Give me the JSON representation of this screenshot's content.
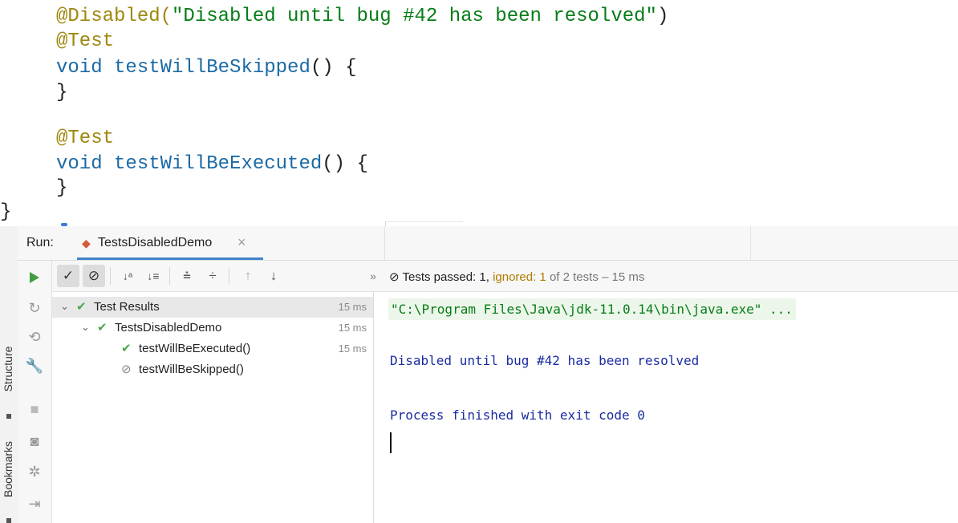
{
  "editor": {
    "disabled_annotation": "@Disabled(",
    "disabled_reason": "\"Disabled until bug #42 has been resolved\"",
    "disabled_close": ")",
    "test_annotation": "@Test",
    "void_keyword": "void",
    "method_skipped": "testWillBeSkipped",
    "method_executed": "testWillBeExecuted",
    "signature_tail": "() {",
    "close_brace": "}",
    "class_close_brace": "}"
  },
  "left_stripe": {
    "structure_label": "Structure",
    "bookmarks_label": "Bookmarks"
  },
  "run": {
    "label": "Run:",
    "tab_title": "TestsDisabledDemo",
    "tab_close": "×"
  },
  "toolbar": {
    "show_passed": "✓",
    "show_ignored": "⊘",
    "sort_alpha": "↓ᵃ",
    "sort_duration": "↓≡",
    "expand_all": "⩮",
    "collapse_all": "÷",
    "prev": "↑",
    "next": "↓",
    "more": "»"
  },
  "status": {
    "icon": "⊘",
    "passed_text": "Tests passed: 1,",
    "ignored_text": "ignored: 1",
    "rest_text": "of 2 tests – 15 ms"
  },
  "tree": {
    "root": {
      "label": "Test Results",
      "time": "15 ms"
    },
    "class": {
      "label": "TestsDisabledDemo",
      "time": "15 ms"
    },
    "tests": [
      {
        "label": "testWillBeExecuted()",
        "time": "15 ms",
        "status": "passed"
      },
      {
        "label": "testWillBeSkipped()",
        "time": "",
        "status": "ignored"
      }
    ]
  },
  "console": {
    "command": "\"C:\\Program Files\\Java\\jdk-11.0.14\\bin\\java.exe\" ...",
    "message": "Disabled until bug #42 has been resolved",
    "process": "Process finished with exit code 0"
  },
  "icons": {
    "run": "play-icon",
    "rerun_failed": "rerun-failed-icon",
    "toggle_autotest": "autotest-icon",
    "settings": "wrench-icon",
    "stop": "stop-icon",
    "screenshot": "camera-icon",
    "debug_config": "bug-icon",
    "exit": "exit-icon"
  },
  "colors": {
    "annotation": "#9e880d",
    "string": "#067d17",
    "keyword": "#1c6aa5",
    "pass": "#4aa84a",
    "ignored_status": "#b07a00",
    "console_text": "#1a2ca0",
    "tab_underline": "#4083c9"
  }
}
